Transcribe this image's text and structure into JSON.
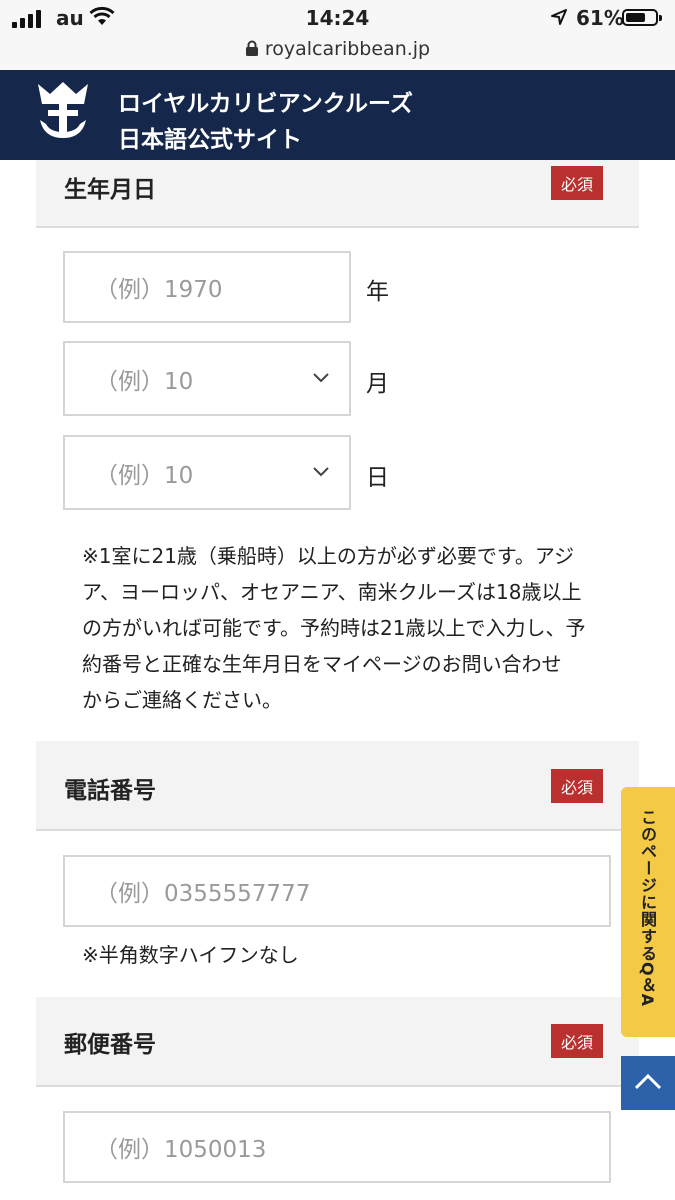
{
  "status_bar": {
    "carrier": "au",
    "time": "14:24",
    "battery": "61%",
    "url": "royalcaribbean.jp"
  },
  "brand": {
    "line1": "ロイヤルカリビアンクルーズ",
    "line2": "日本語公式サイト"
  },
  "birthdate": {
    "label": "生年月日",
    "required": "必須",
    "year": {
      "placeholder": "（例）1970",
      "unit": "年"
    },
    "month": {
      "placeholder": "（例）10",
      "unit": "月"
    },
    "day": {
      "placeholder": "（例）10",
      "unit": "日"
    },
    "note_lines": [
      "※1室に21歳（乗船時）以上の方が必ず必要です。アジ",
      "ア、ヨーロッパ、オセアニア、南米クルーズは18歳以上",
      "の方がいれば可能です。予約時は21歳以上で入力し、予",
      "約番号と正確な生年月日をマイページのお問い合わせ",
      "からご連絡ください。"
    ]
  },
  "phone": {
    "label": "電話番号",
    "required": "必須",
    "placeholder": "（例）0355557777",
    "note": "※半角数字ハイフンなし"
  },
  "postal": {
    "label": "郵便番号",
    "required": "必須",
    "placeholder": "（例）1050013"
  },
  "floating": {
    "qa_label": "このページに関するQ＆A"
  },
  "colors": {
    "header_bg": "#15284b",
    "required_badge": "#b9302f",
    "qa_tab": "#f3c945",
    "to_top": "#2e62a8"
  }
}
